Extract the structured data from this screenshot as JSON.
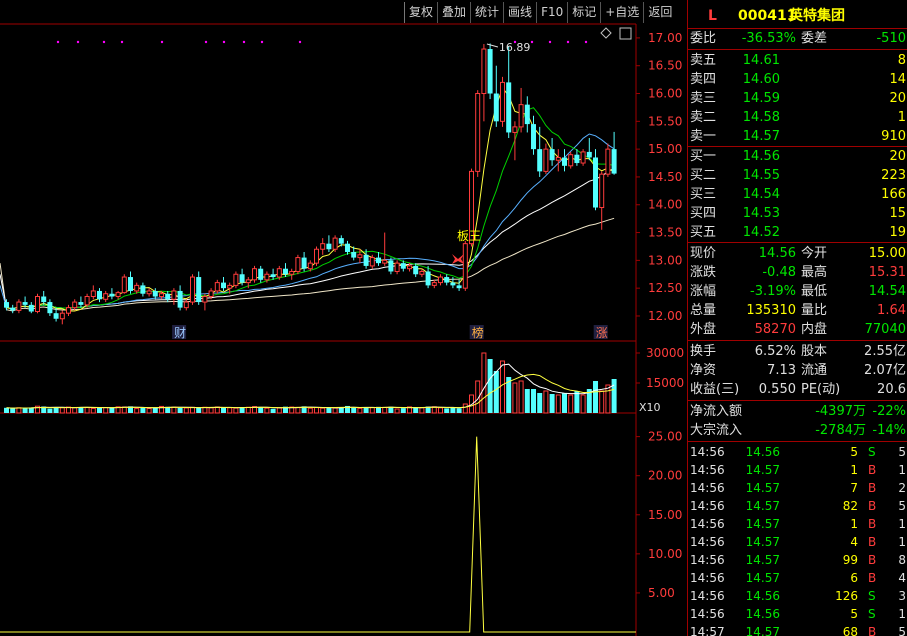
{
  "toolbar": {
    "items": [
      "复权",
      "叠加",
      "统计",
      "画线",
      "F10",
      "标记",
      "+自选",
      "返回"
    ]
  },
  "stock": {
    "prefix": "L",
    "code": "000411",
    "name": "英特集团"
  },
  "order_book": {
    "commission_ratio_label": "委比",
    "commission_ratio": "-36.53%",
    "commission_diff_label": "委差",
    "commission_diff": "-510",
    "sells": [
      {
        "label": "卖五",
        "price": "14.61",
        "vol": "8"
      },
      {
        "label": "卖四",
        "price": "14.60",
        "vol": "14"
      },
      {
        "label": "卖三",
        "price": "14.59",
        "vol": "20"
      },
      {
        "label": "卖二",
        "price": "14.58",
        "vol": "1"
      },
      {
        "label": "卖一",
        "price": "14.57",
        "vol": "910"
      }
    ],
    "buys": [
      {
        "label": "买一",
        "price": "14.56",
        "vol": "20"
      },
      {
        "label": "买二",
        "price": "14.55",
        "vol": "223"
      },
      {
        "label": "买三",
        "price": "14.54",
        "vol": "166"
      },
      {
        "label": "买四",
        "price": "14.53",
        "vol": "15"
      },
      {
        "label": "买五",
        "price": "14.52",
        "vol": "19"
      }
    ]
  },
  "quote": {
    "rows": [
      {
        "l1": "现价",
        "v1": "14.56",
        "l2": "今开",
        "v2": "15.00"
      },
      {
        "l1": "涨跌",
        "v1": "-0.48",
        "l2": "最高",
        "v2": "15.31"
      },
      {
        "l1": "涨幅",
        "v1": "-3.19%",
        "l2": "最低",
        "v2": "14.54"
      },
      {
        "l1": "总量",
        "v1": "135310",
        "l2": "量比",
        "v2": "1.64"
      },
      {
        "l1": "外盘",
        "v1": "58270",
        "l2": "内盘",
        "v2": "77040"
      }
    ]
  },
  "fundamentals": {
    "rows": [
      {
        "l1": "换手",
        "v1": "6.52%",
        "l2": "股本",
        "v2": "2.55亿"
      },
      {
        "l1": "净资",
        "v1": "7.13",
        "l2": "流通",
        "v2": "2.07亿"
      },
      {
        "l1": "收益(三)",
        "v1": "0.550",
        "l2": "PE(动)",
        "v2": "20.6"
      }
    ]
  },
  "flows": [
    {
      "label": "净流入额",
      "value": "-4397万",
      "pct": "-22%"
    },
    {
      "label": "大宗流入",
      "value": "-2784万",
      "pct": "-14%"
    }
  ],
  "ticks": [
    {
      "time": "14:56",
      "price": "14.56",
      "vol": "5",
      "side": "S",
      "n": "5"
    },
    {
      "time": "14:56",
      "price": "14.57",
      "vol": "1",
      "side": "B",
      "n": "1"
    },
    {
      "time": "14:56",
      "price": "14.57",
      "vol": "7",
      "side": "B",
      "n": "2"
    },
    {
      "time": "14:56",
      "price": "14.57",
      "vol": "82",
      "side": "B",
      "n": "5"
    },
    {
      "time": "14:56",
      "price": "14.57",
      "vol": "1",
      "side": "B",
      "n": "1"
    },
    {
      "time": "14:56",
      "price": "14.57",
      "vol": "4",
      "side": "B",
      "n": "1"
    },
    {
      "time": "14:56",
      "price": "14.57",
      "vol": "99",
      "side": "B",
      "n": "8"
    },
    {
      "time": "14:56",
      "price": "14.57",
      "vol": "6",
      "side": "B",
      "n": "4"
    },
    {
      "time": "14:56",
      "price": "14.56",
      "vol": "126",
      "side": "S",
      "n": "3"
    },
    {
      "time": "14:56",
      "price": "14.56",
      "vol": "5",
      "side": "S",
      "n": "1"
    },
    {
      "time": "14:57",
      "price": "14.57",
      "vol": "68",
      "side": "B",
      "n": "5"
    }
  ],
  "chart_data": {
    "type": "candlestick",
    "price_axis": {
      "ticks": [
        "17.00",
        "16.50",
        "16.00",
        "15.50",
        "15.00",
        "14.50",
        "14.00",
        "13.50",
        "13.00",
        "12.50",
        "12.00"
      ],
      "ylim": [
        11.55,
        17.25
      ]
    },
    "high_annotation": "16.89",
    "markers": [
      {
        "text": "财",
        "index": 28
      },
      {
        "text": "榜",
        "index": 76
      },
      {
        "text": "涨",
        "index": 96
      }
    ],
    "tag_label": "板王",
    "volume_axis": {
      "ticks": [
        "30000",
        "15000"
      ],
      "unit": "X10"
    },
    "indicator_axis": {
      "ticks": [
        "25.00",
        "20.00",
        "15.00",
        "10.00",
        "5.00"
      ],
      "ylim": [
        0,
        27
      ]
    },
    "candles": [
      [
        12.25,
        12.3,
        12.1,
        12.15
      ],
      [
        12.15,
        12.2,
        12.05,
        12.1
      ],
      [
        12.1,
        12.3,
        12.05,
        12.25
      ],
      [
        12.25,
        12.35,
        12.15,
        12.2
      ],
      [
        12.2,
        12.25,
        12.05,
        12.08
      ],
      [
        12.08,
        12.4,
        12.05,
        12.35
      ],
      [
        12.35,
        12.45,
        12.2,
        12.25
      ],
      [
        12.25,
        12.3,
        12.0,
        12.05
      ],
      [
        12.05,
        12.15,
        11.9,
        11.95
      ],
      [
        11.95,
        12.1,
        11.85,
        12.05
      ],
      [
        12.05,
        12.2,
        12.0,
        12.15
      ],
      [
        12.15,
        12.3,
        12.1,
        12.25
      ],
      [
        12.25,
        12.35,
        12.15,
        12.2
      ],
      [
        12.2,
        12.4,
        12.15,
        12.35
      ],
      [
        12.35,
        12.55,
        12.3,
        12.45
      ],
      [
        12.45,
        12.5,
        12.25,
        12.3
      ],
      [
        12.3,
        12.45,
        12.25,
        12.4
      ],
      [
        12.4,
        12.5,
        12.3,
        12.35
      ],
      [
        12.35,
        12.45,
        12.3,
        12.42
      ],
      [
        12.42,
        12.75,
        12.4,
        12.7
      ],
      [
        12.7,
        12.8,
        12.4,
        12.45
      ],
      [
        12.45,
        12.6,
        12.4,
        12.55
      ],
      [
        12.55,
        12.6,
        12.35,
        12.4
      ],
      [
        12.4,
        12.5,
        12.35,
        12.45
      ],
      [
        12.45,
        12.5,
        12.3,
        12.35
      ],
      [
        12.35,
        12.45,
        12.3,
        12.4
      ],
      [
        12.4,
        12.45,
        12.25,
        12.3
      ],
      [
        12.3,
        12.5,
        12.2,
        12.45
      ],
      [
        12.45,
        12.55,
        12.1,
        12.15
      ],
      [
        12.15,
        12.3,
        12.1,
        12.25
      ],
      [
        12.25,
        12.75,
        12.2,
        12.7
      ],
      [
        12.7,
        12.8,
        12.2,
        12.25
      ],
      [
        12.25,
        12.4,
        12.1,
        12.35
      ],
      [
        12.35,
        12.5,
        12.3,
        12.45
      ],
      [
        12.45,
        12.65,
        12.4,
        12.6
      ],
      [
        12.6,
        12.7,
        12.45,
        12.5
      ],
      [
        12.5,
        12.6,
        12.4,
        12.55
      ],
      [
        12.55,
        12.8,
        12.5,
        12.75
      ],
      [
        12.75,
        12.85,
        12.55,
        12.6
      ],
      [
        12.6,
        12.7,
        12.5,
        12.65
      ],
      [
        12.65,
        12.9,
        12.6,
        12.85
      ],
      [
        12.85,
        12.9,
        12.6,
        12.65
      ],
      [
        12.65,
        12.8,
        12.6,
        12.75
      ],
      [
        12.75,
        12.85,
        12.65,
        12.7
      ],
      [
        12.7,
        12.9,
        12.65,
        12.85
      ],
      [
        12.85,
        12.95,
        12.7,
        12.75
      ],
      [
        12.75,
        12.85,
        12.65,
        12.8
      ],
      [
        12.8,
        13.1,
        12.75,
        13.05
      ],
      [
        13.05,
        13.15,
        12.8,
        12.85
      ],
      [
        12.85,
        13.0,
        12.8,
        12.95
      ],
      [
        12.95,
        13.25,
        12.9,
        13.2
      ],
      [
        13.2,
        13.4,
        13.1,
        13.3
      ],
      [
        13.3,
        13.45,
        13.15,
        13.2
      ],
      [
        13.2,
        13.45,
        13.15,
        13.4
      ],
      [
        13.4,
        13.45,
        13.25,
        13.3
      ],
      [
        13.3,
        13.35,
        13.1,
        13.15
      ],
      [
        13.15,
        13.25,
        13.0,
        13.05
      ],
      [
        13.05,
        13.2,
        12.95,
        13.1
      ],
      [
        13.1,
        13.2,
        12.85,
        12.9
      ],
      [
        12.9,
        13.1,
        12.85,
        13.05
      ],
      [
        13.05,
        13.15,
        12.9,
        12.95
      ],
      [
        12.95,
        13.5,
        12.9,
        13.0
      ],
      [
        13.0,
        13.05,
        12.75,
        12.8
      ],
      [
        12.8,
        13.0,
        12.75,
        12.95
      ],
      [
        12.95,
        13.0,
        12.8,
        12.85
      ],
      [
        12.85,
        12.95,
        12.8,
        12.9
      ],
      [
        12.9,
        12.95,
        12.7,
        12.75
      ],
      [
        12.75,
        12.85,
        12.7,
        12.8
      ],
      [
        12.8,
        12.9,
        12.5,
        12.55
      ],
      [
        12.55,
        12.65,
        12.5,
        12.6
      ],
      [
        12.6,
        12.75,
        12.55,
        12.7
      ],
      [
        12.7,
        12.75,
        12.55,
        12.6
      ],
      [
        12.6,
        12.7,
        12.5,
        12.55
      ],
      [
        12.55,
        12.65,
        12.45,
        12.5
      ],
      [
        12.5,
        13.35,
        12.45,
        13.3
      ],
      [
        13.3,
        14.65,
        13.25,
        14.6
      ],
      [
        14.6,
        16.06,
        14.5,
        16.0
      ],
      [
        16.0,
        16.89,
        15.5,
        16.8
      ],
      [
        16.8,
        16.9,
        15.9,
        16.0
      ],
      [
        16.0,
        16.5,
        15.4,
        15.5
      ],
      [
        15.5,
        16.3,
        15.4,
        16.2
      ],
      [
        16.2,
        16.85,
        15.2,
        15.3
      ],
      [
        15.3,
        15.5,
        14.8,
        15.4
      ],
      [
        15.4,
        16.1,
        15.3,
        15.8
      ],
      [
        15.8,
        15.95,
        15.3,
        15.45
      ],
      [
        15.45,
        15.6,
        14.9,
        15.0
      ],
      [
        15.0,
        15.4,
        14.5,
        14.6
      ],
      [
        14.6,
        15.1,
        14.55,
        15.0
      ],
      [
        15.0,
        15.2,
        14.7,
        14.8
      ],
      [
        14.8,
        15.0,
        14.6,
        14.85
      ],
      [
        14.85,
        15.0,
        14.6,
        14.7
      ],
      [
        14.7,
        14.95,
        14.65,
        14.9
      ],
      [
        14.9,
        15.0,
        14.7,
        14.75
      ],
      [
        14.75,
        15.0,
        14.7,
        14.95
      ],
      [
        14.95,
        15.2,
        14.8,
        14.85
      ],
      [
        14.85,
        15.0,
        13.9,
        13.95
      ],
      [
        13.95,
        14.6,
        13.55,
        14.55
      ],
      [
        14.55,
        15.1,
        14.5,
        15.0
      ],
      [
        15.0,
        15.31,
        14.54,
        14.56
      ]
    ],
    "indicator_peak": {
      "index": 76,
      "value": 25.0
    }
  }
}
